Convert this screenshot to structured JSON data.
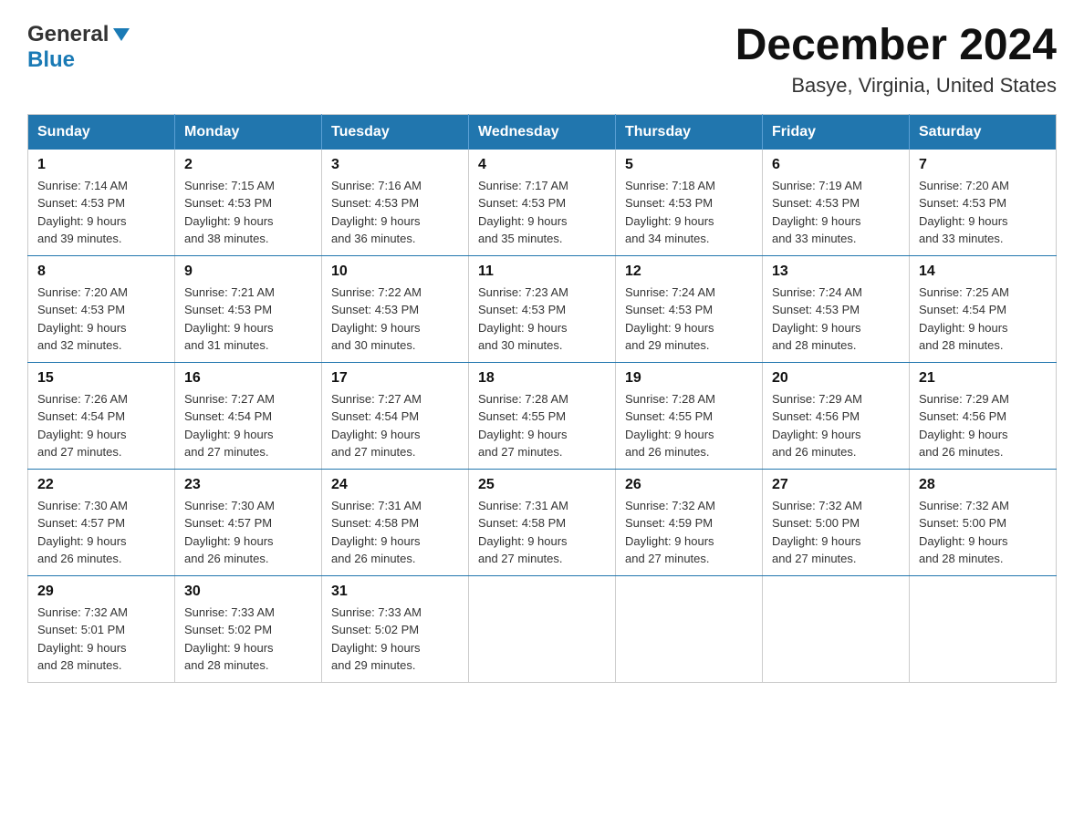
{
  "header": {
    "logo_general": "General",
    "logo_blue": "Blue",
    "title": "December 2024",
    "subtitle": "Basye, Virginia, United States"
  },
  "days_of_week": [
    "Sunday",
    "Monday",
    "Tuesday",
    "Wednesday",
    "Thursday",
    "Friday",
    "Saturday"
  ],
  "weeks": [
    [
      {
        "day": "1",
        "sunrise": "Sunrise: 7:14 AM",
        "sunset": "Sunset: 4:53 PM",
        "daylight": "Daylight: 9 hours and 39 minutes."
      },
      {
        "day": "2",
        "sunrise": "Sunrise: 7:15 AM",
        "sunset": "Sunset: 4:53 PM",
        "daylight": "Daylight: 9 hours and 38 minutes."
      },
      {
        "day": "3",
        "sunrise": "Sunrise: 7:16 AM",
        "sunset": "Sunset: 4:53 PM",
        "daylight": "Daylight: 9 hours and 36 minutes."
      },
      {
        "day": "4",
        "sunrise": "Sunrise: 7:17 AM",
        "sunset": "Sunset: 4:53 PM",
        "daylight": "Daylight: 9 hours and 35 minutes."
      },
      {
        "day": "5",
        "sunrise": "Sunrise: 7:18 AM",
        "sunset": "Sunset: 4:53 PM",
        "daylight": "Daylight: 9 hours and 34 minutes."
      },
      {
        "day": "6",
        "sunrise": "Sunrise: 7:19 AM",
        "sunset": "Sunset: 4:53 PM",
        "daylight": "Daylight: 9 hours and 33 minutes."
      },
      {
        "day": "7",
        "sunrise": "Sunrise: 7:20 AM",
        "sunset": "Sunset: 4:53 PM",
        "daylight": "Daylight: 9 hours and 33 minutes."
      }
    ],
    [
      {
        "day": "8",
        "sunrise": "Sunrise: 7:20 AM",
        "sunset": "Sunset: 4:53 PM",
        "daylight": "Daylight: 9 hours and 32 minutes."
      },
      {
        "day": "9",
        "sunrise": "Sunrise: 7:21 AM",
        "sunset": "Sunset: 4:53 PM",
        "daylight": "Daylight: 9 hours and 31 minutes."
      },
      {
        "day": "10",
        "sunrise": "Sunrise: 7:22 AM",
        "sunset": "Sunset: 4:53 PM",
        "daylight": "Daylight: 9 hours and 30 minutes."
      },
      {
        "day": "11",
        "sunrise": "Sunrise: 7:23 AM",
        "sunset": "Sunset: 4:53 PM",
        "daylight": "Daylight: 9 hours and 30 minutes."
      },
      {
        "day": "12",
        "sunrise": "Sunrise: 7:24 AM",
        "sunset": "Sunset: 4:53 PM",
        "daylight": "Daylight: 9 hours and 29 minutes."
      },
      {
        "day": "13",
        "sunrise": "Sunrise: 7:24 AM",
        "sunset": "Sunset: 4:53 PM",
        "daylight": "Daylight: 9 hours and 28 minutes."
      },
      {
        "day": "14",
        "sunrise": "Sunrise: 7:25 AM",
        "sunset": "Sunset: 4:54 PM",
        "daylight": "Daylight: 9 hours and 28 minutes."
      }
    ],
    [
      {
        "day": "15",
        "sunrise": "Sunrise: 7:26 AM",
        "sunset": "Sunset: 4:54 PM",
        "daylight": "Daylight: 9 hours and 27 minutes."
      },
      {
        "day": "16",
        "sunrise": "Sunrise: 7:27 AM",
        "sunset": "Sunset: 4:54 PM",
        "daylight": "Daylight: 9 hours and 27 minutes."
      },
      {
        "day": "17",
        "sunrise": "Sunrise: 7:27 AM",
        "sunset": "Sunset: 4:54 PM",
        "daylight": "Daylight: 9 hours and 27 minutes."
      },
      {
        "day": "18",
        "sunrise": "Sunrise: 7:28 AM",
        "sunset": "Sunset: 4:55 PM",
        "daylight": "Daylight: 9 hours and 27 minutes."
      },
      {
        "day": "19",
        "sunrise": "Sunrise: 7:28 AM",
        "sunset": "Sunset: 4:55 PM",
        "daylight": "Daylight: 9 hours and 26 minutes."
      },
      {
        "day": "20",
        "sunrise": "Sunrise: 7:29 AM",
        "sunset": "Sunset: 4:56 PM",
        "daylight": "Daylight: 9 hours and 26 minutes."
      },
      {
        "day": "21",
        "sunrise": "Sunrise: 7:29 AM",
        "sunset": "Sunset: 4:56 PM",
        "daylight": "Daylight: 9 hours and 26 minutes."
      }
    ],
    [
      {
        "day": "22",
        "sunrise": "Sunrise: 7:30 AM",
        "sunset": "Sunset: 4:57 PM",
        "daylight": "Daylight: 9 hours and 26 minutes."
      },
      {
        "day": "23",
        "sunrise": "Sunrise: 7:30 AM",
        "sunset": "Sunset: 4:57 PM",
        "daylight": "Daylight: 9 hours and 26 minutes."
      },
      {
        "day": "24",
        "sunrise": "Sunrise: 7:31 AM",
        "sunset": "Sunset: 4:58 PM",
        "daylight": "Daylight: 9 hours and 26 minutes."
      },
      {
        "day": "25",
        "sunrise": "Sunrise: 7:31 AM",
        "sunset": "Sunset: 4:58 PM",
        "daylight": "Daylight: 9 hours and 27 minutes."
      },
      {
        "day": "26",
        "sunrise": "Sunrise: 7:32 AM",
        "sunset": "Sunset: 4:59 PM",
        "daylight": "Daylight: 9 hours and 27 minutes."
      },
      {
        "day": "27",
        "sunrise": "Sunrise: 7:32 AM",
        "sunset": "Sunset: 5:00 PM",
        "daylight": "Daylight: 9 hours and 27 minutes."
      },
      {
        "day": "28",
        "sunrise": "Sunrise: 7:32 AM",
        "sunset": "Sunset: 5:00 PM",
        "daylight": "Daylight: 9 hours and 28 minutes."
      }
    ],
    [
      {
        "day": "29",
        "sunrise": "Sunrise: 7:32 AM",
        "sunset": "Sunset: 5:01 PM",
        "daylight": "Daylight: 9 hours and 28 minutes."
      },
      {
        "day": "30",
        "sunrise": "Sunrise: 7:33 AM",
        "sunset": "Sunset: 5:02 PM",
        "daylight": "Daylight: 9 hours and 28 minutes."
      },
      {
        "day": "31",
        "sunrise": "Sunrise: 7:33 AM",
        "sunset": "Sunset: 5:02 PM",
        "daylight": "Daylight: 9 hours and 29 minutes."
      },
      null,
      null,
      null,
      null
    ]
  ]
}
